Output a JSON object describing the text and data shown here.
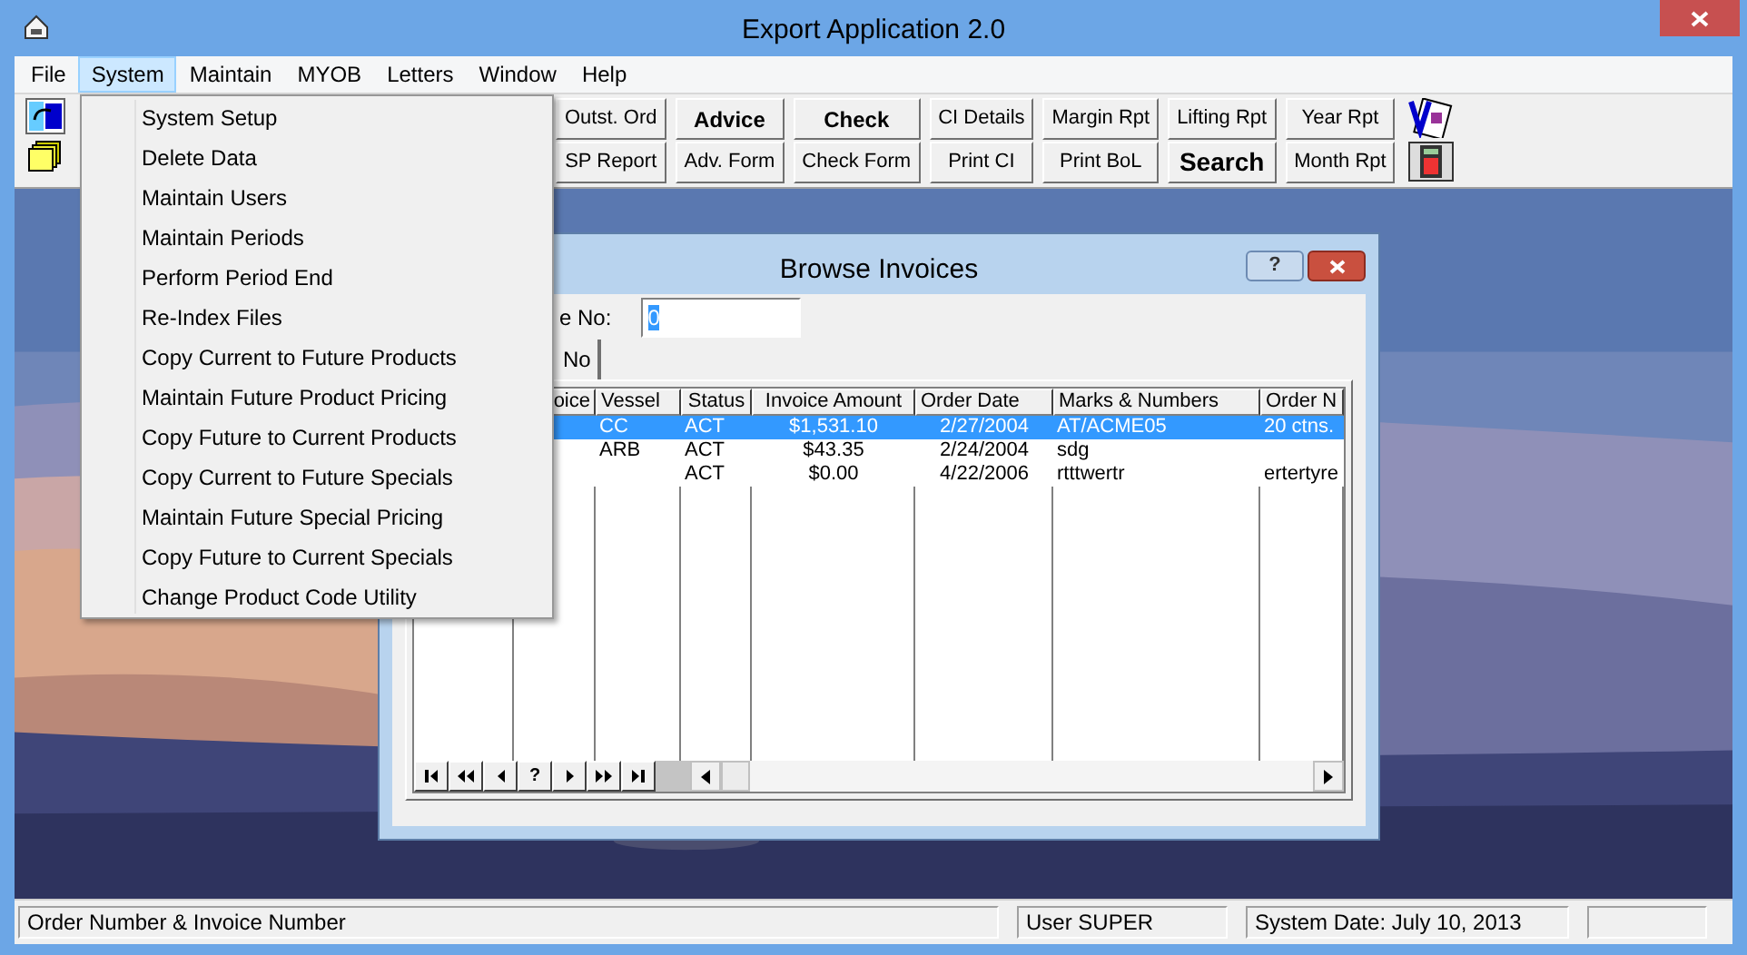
{
  "window": {
    "title": "Export Application 2.0"
  },
  "menu_bar": [
    {
      "label": "File",
      "selected": false
    },
    {
      "label": "System",
      "selected": true
    },
    {
      "label": "Maintain",
      "selected": false
    },
    {
      "label": "MYOB",
      "selected": false
    },
    {
      "label": "Letters",
      "selected": false
    },
    {
      "label": "Window",
      "selected": false
    },
    {
      "label": "Help",
      "selected": false
    }
  ],
  "toolbar": [
    {
      "top": {
        "label": "Outst. Ord",
        "kind": "normal"
      },
      "bottom": {
        "label": "SP Report",
        "kind": "normal"
      }
    },
    {
      "top": {
        "label": "Advice",
        "kind": "bold"
      },
      "bottom": {
        "label": "Adv. Form",
        "kind": "normal"
      }
    },
    {
      "top": {
        "label": "Check",
        "kind": "bold"
      },
      "bottom": {
        "label": "Check Form",
        "kind": "normal"
      }
    },
    {
      "top": {
        "label": "CI Details",
        "kind": "normal"
      },
      "bottom": {
        "label": "Print CI",
        "kind": "normal"
      }
    },
    {
      "top": {
        "label": "Margin Rpt",
        "kind": "normal"
      },
      "bottom": {
        "label": "Print BoL",
        "kind": "normal"
      }
    },
    {
      "top": {
        "label": "Lifting Rpt",
        "kind": "normal"
      },
      "bottom": {
        "label": "Search",
        "kind": "big"
      }
    },
    {
      "top": {
        "label": "Year Rpt",
        "kind": "normal"
      },
      "bottom": {
        "label": "Month Rpt",
        "kind": "normal"
      }
    }
  ],
  "system_menu": [
    "System Setup",
    "Delete Data",
    "Maintain Users",
    "Maintain Periods",
    "Perform Period End",
    "Re-Index Files",
    "Copy Current to Future Products",
    "Maintain Future Product Pricing",
    "Copy Future to Current Products",
    "Copy Current to Future Specials",
    "Maintain Future Special Pricing",
    "Copy Future to Current Specials",
    "Change Product Code Utility"
  ],
  "browse_dialog": {
    "title": "Browse Invoices",
    "help_label": "?",
    "search_label": "e No:",
    "search_value": "0",
    "tab": {
      "label": "No",
      "selected": true
    },
    "columns": [
      "oice",
      "Vessel",
      "Status",
      "Invoice Amount",
      "Order Date",
      "Marks & Numbers",
      "Order N"
    ],
    "rows": [
      {
        "selected": true,
        "cells": [
          null,
          "CC",
          "ACT",
          "$1,531.10",
          "2/27/2004",
          "AT/ACME05",
          "20 ctns."
        ]
      },
      {
        "selected": false,
        "cells": [
          null,
          "ARB",
          "ACT",
          "$43.35",
          "2/24/2004",
          "sdg",
          null
        ]
      },
      {
        "selected": false,
        "cells": [
          null,
          null,
          "ACT",
          "$0.00",
          "4/22/2006",
          "rtttwertr",
          "ertertyre"
        ]
      }
    ],
    "navigator": [
      {
        "kind": "first"
      },
      {
        "kind": "prev-page"
      },
      {
        "kind": "prev"
      },
      {
        "kind": "find",
        "label": "?"
      },
      {
        "kind": "next"
      },
      {
        "kind": "next-page"
      },
      {
        "kind": "last"
      }
    ]
  },
  "status_bar": [
    "Order Number & Invoice Number",
    "User SUPER",
    "System Date: July 10, 2013"
  ]
}
